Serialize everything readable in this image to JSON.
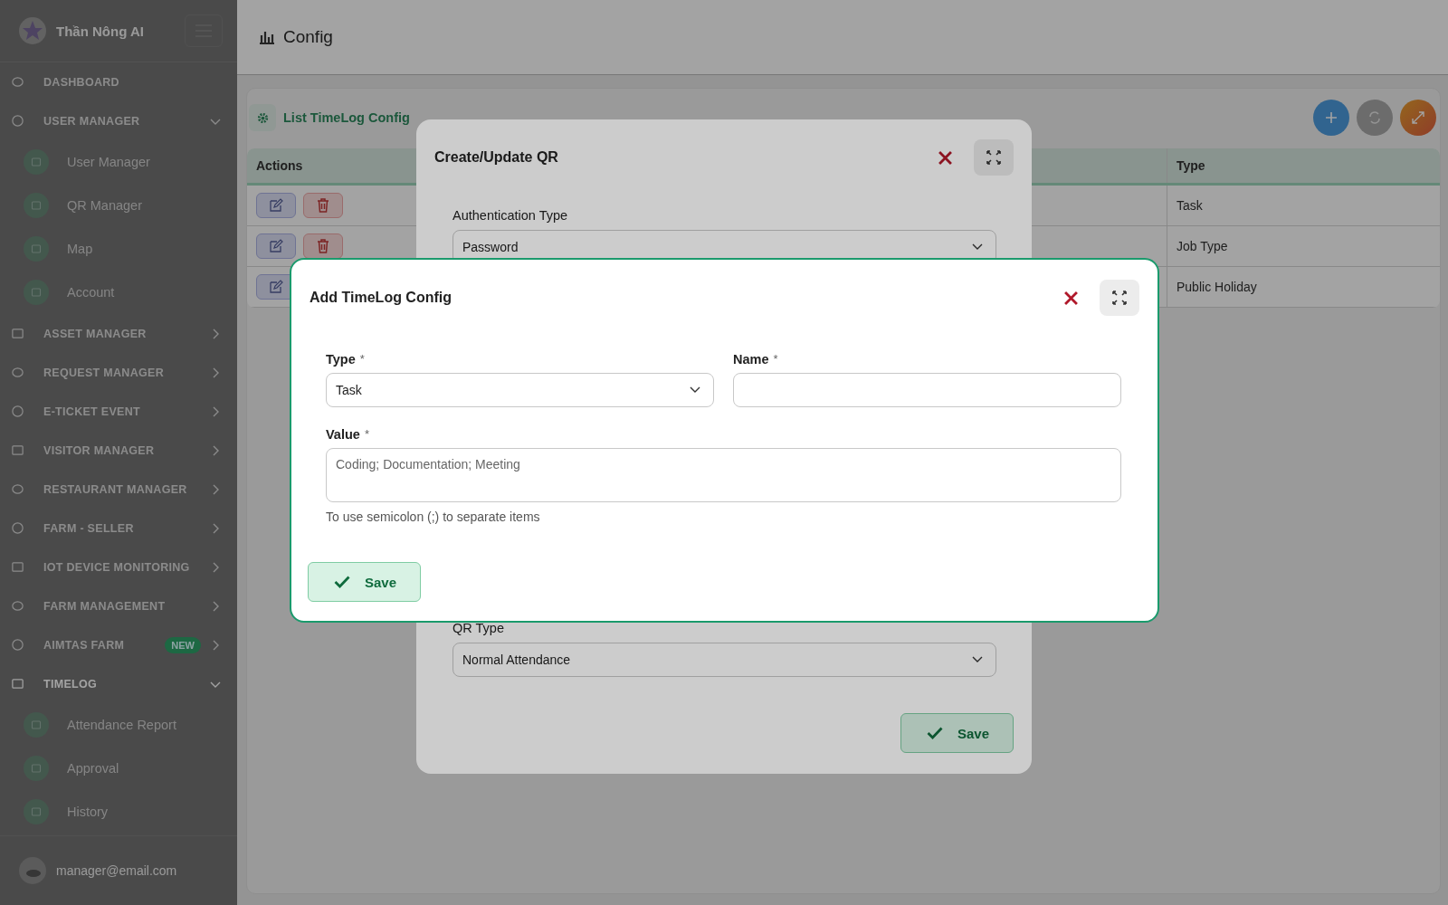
{
  "brand": {
    "name": "Thần Nông AI"
  },
  "sidebar": {
    "items": [
      {
        "label": "DASHBOARD",
        "kind": "link",
        "selected": false
      },
      {
        "label": "USER MANAGER",
        "kind": "group",
        "selected": false,
        "expanded": true,
        "children": [
          {
            "label": "User Manager",
            "selected": false
          },
          {
            "label": "QR Manager",
            "selected": false
          },
          {
            "label": "Map",
            "selected": false
          },
          {
            "label": "Account",
            "selected": false
          }
        ]
      },
      {
        "label": "ASSET MANAGER",
        "kind": "group",
        "selected": false,
        "expanded": false
      },
      {
        "label": "REQUEST MANAGER",
        "kind": "group",
        "selected": false,
        "expanded": false
      },
      {
        "label": "E-TICKET EVENT",
        "kind": "group",
        "selected": false,
        "expanded": false
      },
      {
        "label": "VISITOR MANAGER",
        "kind": "group",
        "selected": false,
        "expanded": false
      },
      {
        "label": "RESTAURANT MANAGER",
        "kind": "group",
        "selected": false,
        "expanded": false
      },
      {
        "label": "FARM - SELLER",
        "kind": "group",
        "selected": false,
        "expanded": false
      },
      {
        "label": "IOT DEVICE MONITORING",
        "kind": "group",
        "selected": false,
        "expanded": false
      },
      {
        "label": "FARM MANAGEMENT",
        "kind": "group",
        "selected": false,
        "expanded": false
      },
      {
        "label": "AIMTAS FARM",
        "kind": "group",
        "selected": false,
        "expanded": false,
        "badge": "NEW"
      },
      {
        "label": "TIMELOG",
        "kind": "group",
        "selected": true,
        "expanded": true,
        "children": [
          {
            "label": "Attendance Report",
            "selected": false
          },
          {
            "label": "Approval",
            "selected": false
          },
          {
            "label": "History",
            "selected": false
          }
        ]
      }
    ]
  },
  "user": {
    "email": "manager@email.com"
  },
  "header": {
    "title": "Config"
  },
  "panel": {
    "title": "List TimeLog Config",
    "table": {
      "columns": [
        "Actions",
        "Type"
      ],
      "rows": [
        {
          "actions": [
            {
              "kind": "edit"
            },
            {
              "kind": "delete"
            }
          ],
          "type": "Task"
        },
        {
          "actions": [
            {
              "kind": "edit"
            },
            {
              "kind": "delete"
            }
          ],
          "type": "Job Type"
        },
        {
          "actions": [
            {
              "kind": "edit"
            }
          ],
          "type": "Public Holiday"
        }
      ]
    }
  },
  "qr_dialog": {
    "title": "Create/Update QR",
    "fields": [
      {
        "label": "Authentication Type",
        "value": "Password"
      },
      {
        "label": "QR Type",
        "value": "Normal Attendance"
      }
    ],
    "save": "Save"
  },
  "config_dialog": {
    "title": "Add TimeLog Config",
    "type_field": {
      "label": "Type",
      "mark": "*",
      "value": "Task"
    },
    "name_field": {
      "label": "Name",
      "mark": "*"
    },
    "value_field": {
      "label": "Value",
      "mark": "*",
      "placeholder": "Coding; Documentation; Meeting"
    },
    "help": "To use semicolon (;) to separate items",
    "save": "Save"
  }
}
